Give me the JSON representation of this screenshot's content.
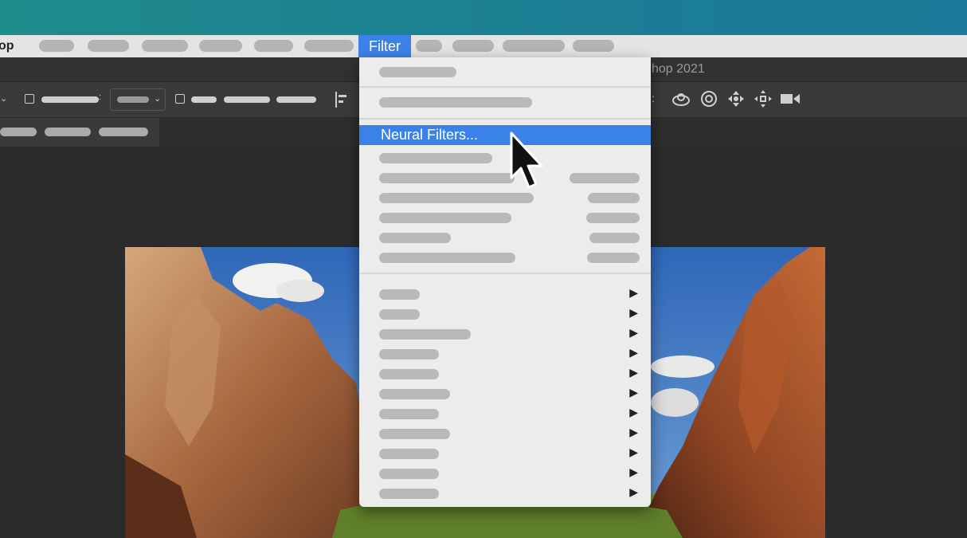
{
  "menubar": {
    "app_name_fragment": "op",
    "active_menu": "Filter"
  },
  "window": {
    "title_fragment": "hop 2021"
  },
  "filter_menu": {
    "highlighted_item": "Neural Filters...",
    "top_items": 2,
    "middle_items_count": 6,
    "submenu_items_count": 11,
    "submenu_arrow": "▶"
  },
  "colors": {
    "accent": "#3b82e8",
    "desktop": "#1b7e94",
    "menu_bg": "#ececec"
  },
  "icons": [
    "cursor-arrow-icon",
    "checkbox-icon",
    "align-icon",
    "3d-orbit-icon",
    "3d-roll-icon",
    "3d-pan-icon",
    "3d-slide-icon",
    "3d-camera-icon"
  ]
}
